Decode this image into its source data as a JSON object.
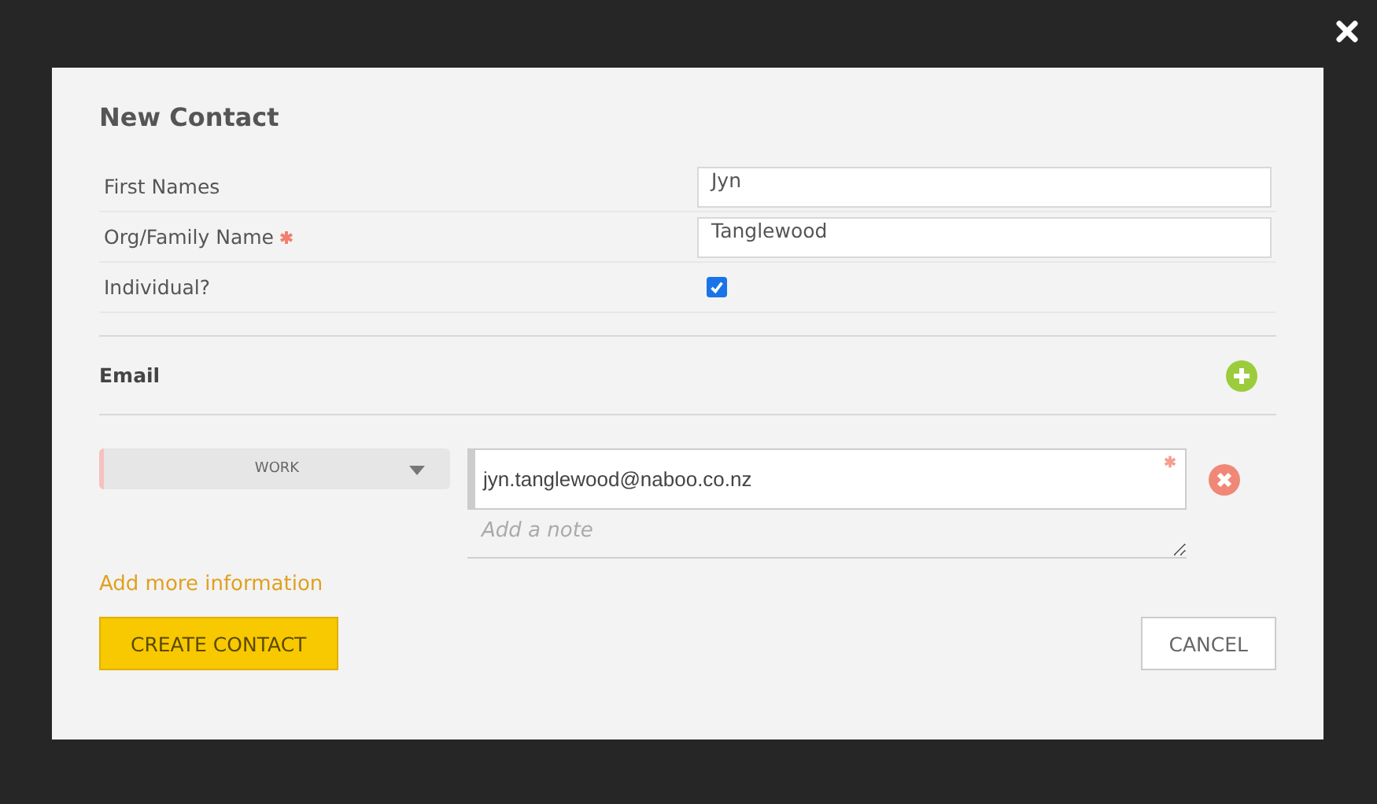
{
  "dialog": {
    "title": "New Contact"
  },
  "fields": [
    {
      "kind": "text",
      "label": "First Names",
      "required": false,
      "value": "Jyn"
    },
    {
      "kind": "text",
      "label": "Org/Family Name",
      "required": true,
      "value": "Tanglewood"
    },
    {
      "kind": "checkbox",
      "label": "Individual?",
      "required": false,
      "checked": true
    }
  ],
  "email_section": {
    "title": "Email",
    "entries": [
      {
        "type": "WORK",
        "value": "jyn.tanglewood@naboo.co.nz",
        "required": true,
        "note_placeholder": "Add a note"
      }
    ]
  },
  "more_link": "Add more information",
  "buttons": [
    {
      "kind": "primary",
      "label": "CREATE CONTACT"
    },
    {
      "kind": "secondary",
      "label": "CANCEL"
    }
  ]
}
